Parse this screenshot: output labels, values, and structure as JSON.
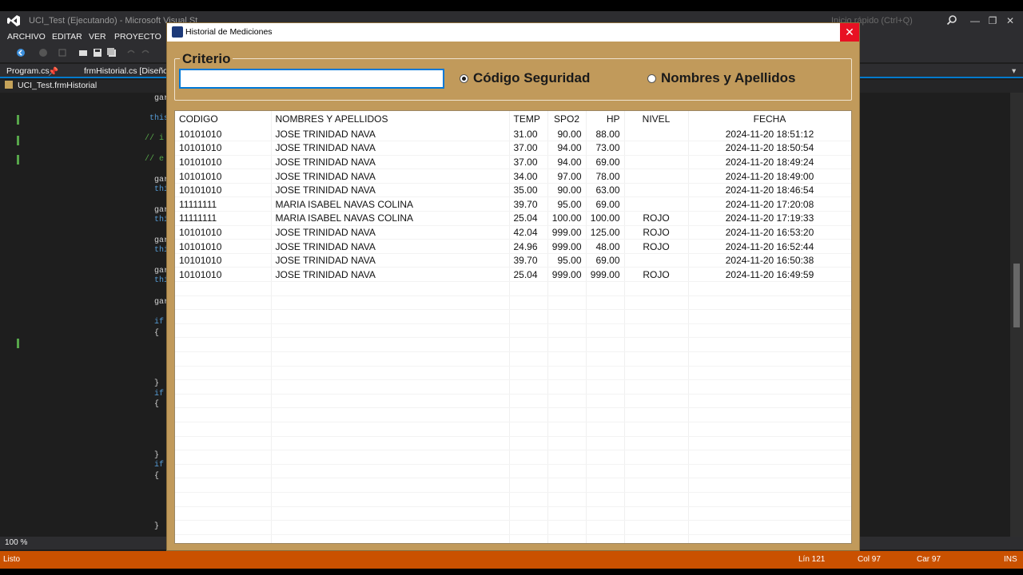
{
  "vs": {
    "window_title": "UCI_Test (Ejecutando) - Microsoft Visual St",
    "quick_launch": "Inicio rápido (Ctrl+Q)",
    "menu": [
      "ARCHIVO",
      "EDITAR",
      "VER",
      "PROYECTO"
    ],
    "tabs": {
      "program": "Program.cs",
      "designer": "frmHistorial.cs [Diseño]"
    },
    "nav_class": "UCI_Test.frmHistorial",
    "code": {
      "gar": "gar",
      "this": "this",
      "thi": "thi",
      "if": "if",
      "brace": "{",
      "close_brace": "}",
      "comment_a": "//  i",
      "comment_b": "//  e"
    },
    "zoom": "100 %",
    "status": {
      "ready": "Listo",
      "line": "Lín 121",
      "col": "Col 97",
      "car": "Car 97",
      "ins": "INS"
    }
  },
  "dialog": {
    "title": "Historial de Mediciones",
    "close_glyph": "✕",
    "criteria_label": "Criterio",
    "search_value": "",
    "radio_code": "Código Seguridad",
    "radio_names": "Nombres y Apellidos",
    "selected": "code"
  },
  "grid": {
    "headers": {
      "codigo": "CODIGO",
      "nombres": "NOMBRES Y APELLIDOS",
      "temp": "TEMP",
      "spo2": "SPO2",
      "hp": "HP",
      "nivel": "NIVEL",
      "fecha": "FECHA"
    },
    "rows": [
      {
        "codigo": "10101010",
        "nombres": "JOSE TRINIDAD NAVA",
        "temp": "31.00",
        "spo2": "90.00",
        "hp": "88.00",
        "nivel": "",
        "fecha": "2024-11-20 18:51:12"
      },
      {
        "codigo": "10101010",
        "nombres": "JOSE TRINIDAD NAVA",
        "temp": "37.00",
        "spo2": "94.00",
        "hp": "73.00",
        "nivel": "",
        "fecha": "2024-11-20 18:50:54"
      },
      {
        "codigo": "10101010",
        "nombres": "JOSE TRINIDAD NAVA",
        "temp": "37.00",
        "spo2": "94.00",
        "hp": "69.00",
        "nivel": "",
        "fecha": "2024-11-20 18:49:24"
      },
      {
        "codigo": "10101010",
        "nombres": "JOSE TRINIDAD NAVA",
        "temp": "34.00",
        "spo2": "97.00",
        "hp": "78.00",
        "nivel": "",
        "fecha": "2024-11-20 18:49:00"
      },
      {
        "codigo": "10101010",
        "nombres": "JOSE TRINIDAD NAVA",
        "temp": "35.00",
        "spo2": "90.00",
        "hp": "63.00",
        "nivel": "",
        "fecha": "2024-11-20 18:46:54"
      },
      {
        "codigo": "11111111",
        "nombres": "MARIA ISABEL NAVAS COLINA",
        "temp": "39.70",
        "spo2": "95.00",
        "hp": "69.00",
        "nivel": "",
        "fecha": "2024-11-20 17:20:08"
      },
      {
        "codigo": "11111111",
        "nombres": "MARIA ISABEL NAVAS COLINA",
        "temp": "25.04",
        "spo2": "100.00",
        "hp": "100.00",
        "nivel": "ROJO",
        "fecha": "2024-11-20 17:19:33"
      },
      {
        "codigo": "10101010",
        "nombres": "JOSE TRINIDAD NAVA",
        "temp": "42.04",
        "spo2": "999.00",
        "hp": "125.00",
        "nivel": "ROJO",
        "fecha": "2024-11-20 16:53:20"
      },
      {
        "codigo": "10101010",
        "nombres": "JOSE TRINIDAD NAVA",
        "temp": "24.96",
        "spo2": "999.00",
        "hp": "48.00",
        "nivel": "ROJO",
        "fecha": "2024-11-20 16:52:44"
      },
      {
        "codigo": "10101010",
        "nombres": "JOSE TRINIDAD NAVA",
        "temp": "39.70",
        "spo2": "95.00",
        "hp": "69.00",
        "nivel": "",
        "fecha": "2024-11-20 16:50:38"
      },
      {
        "codigo": "10101010",
        "nombres": "JOSE TRINIDAD NAVA",
        "temp": "25.04",
        "spo2": "999.00",
        "hp": "999.00",
        "nivel": "ROJO",
        "fecha": "2024-11-20 16:49:59"
      }
    ]
  }
}
